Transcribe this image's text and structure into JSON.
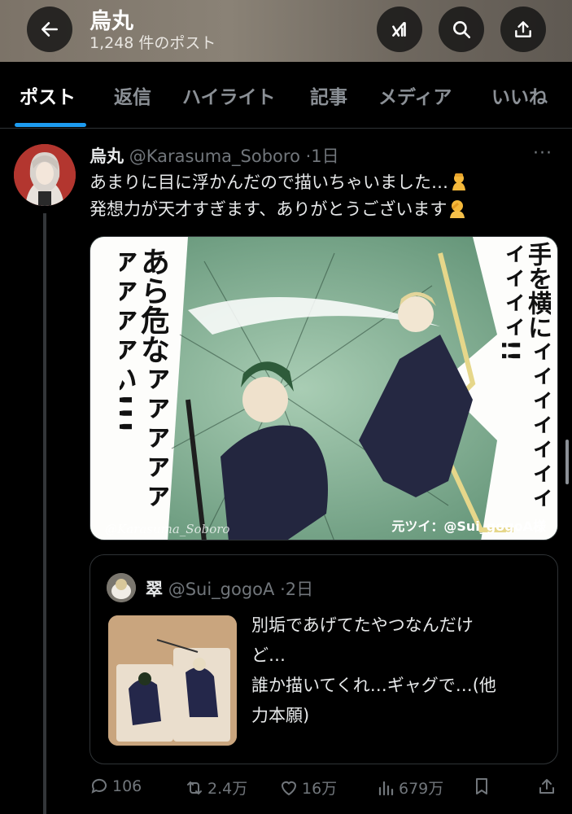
{
  "header": {
    "title": "烏丸",
    "post_count": "1,248 件のポスト",
    "icons": [
      "back-arrow-icon",
      "grok-icon",
      "search-icon",
      "share-icon"
    ]
  },
  "tabs": [
    {
      "label": "ポスト",
      "active": true
    },
    {
      "label": "返信",
      "active": false
    },
    {
      "label": "ハイライト",
      "active": false
    },
    {
      "label": "記事",
      "active": false
    },
    {
      "label": "メディア",
      "active": false
    },
    {
      "label": "いいね",
      "active": false
    }
  ],
  "tweet": {
    "name": "烏丸",
    "handle": "@Karasuma_Soboro",
    "time": "·1日",
    "more": "···",
    "line1": "あまりに目に浮かんだので描いちゃいました…",
    "line2": "発想力が天才すぎます、ありがとうございます",
    "media": {
      "text_left": "あら危なァァァァァァァァァい!!!",
      "text_right": "手を横にィィィィィィィィィィィ!!",
      "watermark": "@Karasuma_Soboro",
      "credit": "元ツイ：@Sui_gogoA様"
    }
  },
  "quote": {
    "name": "翠",
    "handle": "@Sui_gogoA",
    "time": "·2日",
    "line1": "別垢であげてたやつなんだけ",
    "line2": "ど…",
    "line3": "誰か描いてくれ…ギャグで…(他",
    "line4": "力本願)"
  },
  "actions": {
    "replies": "106",
    "reposts": "2.4万",
    "likes": "16万",
    "views": "679万"
  },
  "colors": {
    "accent": "#1d9bf0",
    "background": "#000000",
    "muted": "#71767b"
  }
}
